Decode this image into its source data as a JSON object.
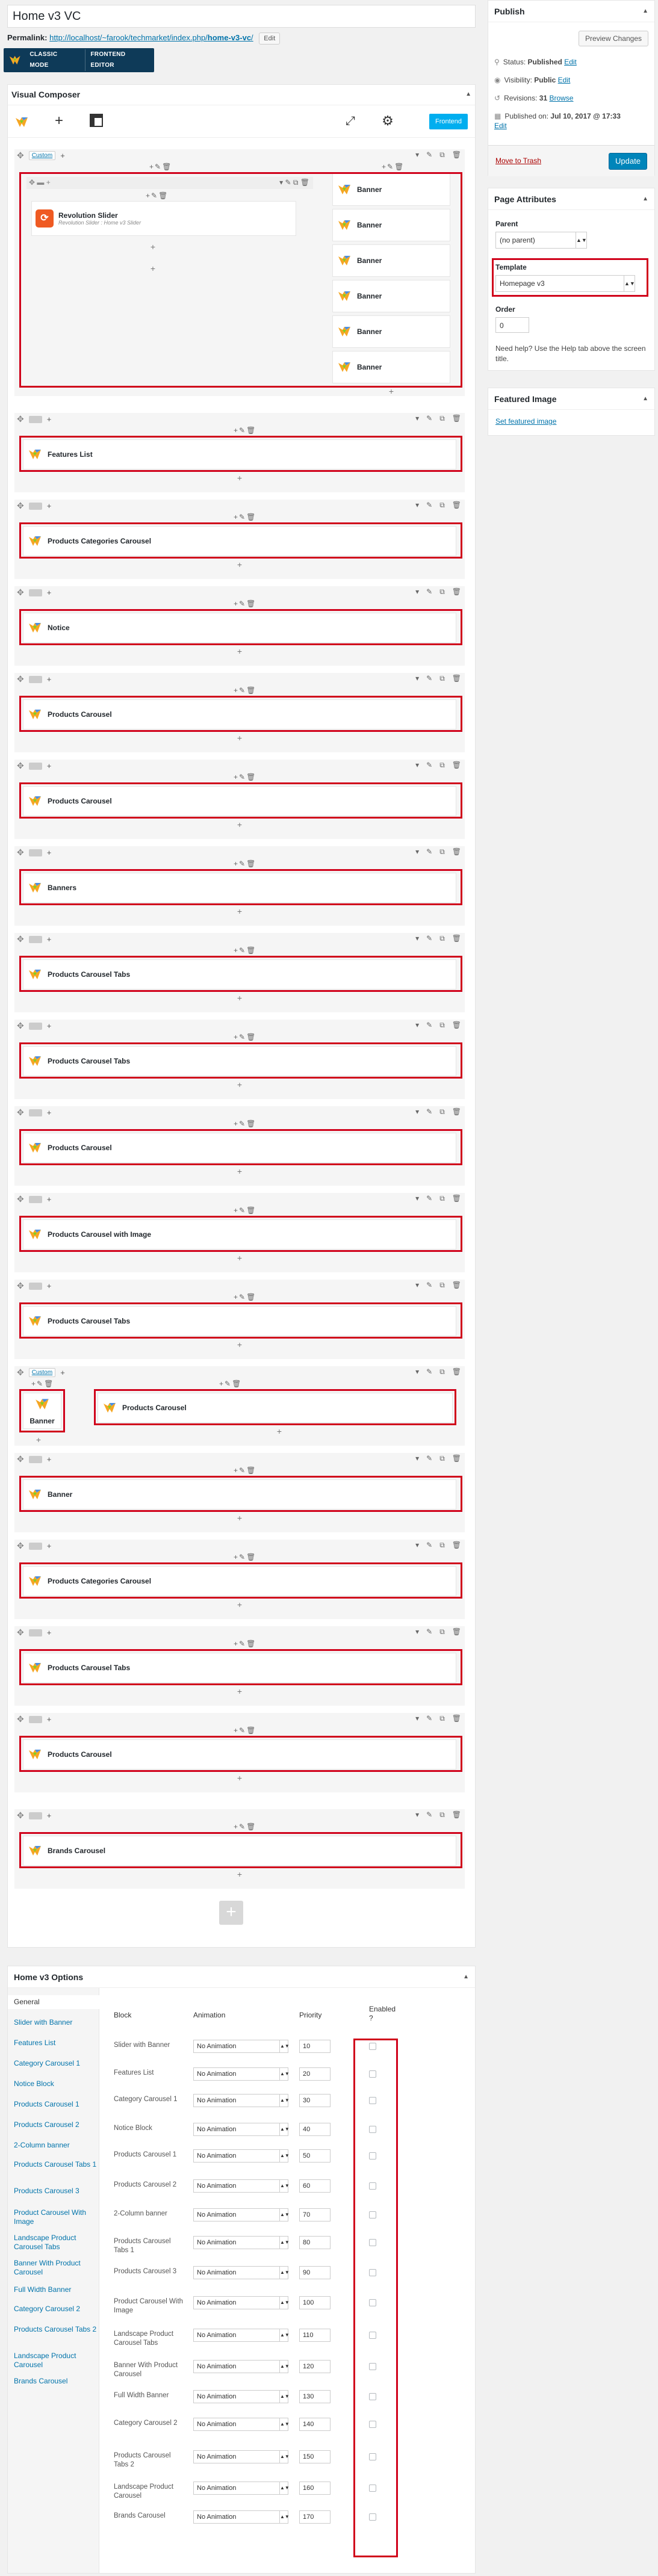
{
  "page_title": "Home v3 VC",
  "permalink": {
    "label": "Permalink:",
    "url_prefix": "http://localhost/~farook/techmarket/index.php/",
    "url_slug": "home-v3-vc",
    "url_suffix": "/",
    "edit": "Edit"
  },
  "mode": {
    "classic": "CLASSIC MODE",
    "frontend": "FRONTEND EDITOR"
  },
  "vc": {
    "title": "Visual Composer",
    "frontend": "Frontend",
    "custom": "Custom"
  },
  "rev_slider": {
    "name": "Revolution Slider",
    "sub": "Revolution Slider : Home v3 Slider"
  },
  "banner_label": "Banner",
  "rows": [
    "Features List",
    "Products Categories Carousel",
    "Notice",
    "Products Carousel",
    "Products Carousel",
    "Banners",
    "Products Carousel Tabs",
    "Products Carousel Tabs",
    "Products Carousel",
    "Products Carousel with Image",
    "Products Carousel Tabs"
  ],
  "split_row": {
    "left": "Banner",
    "right": "Products Carousel"
  },
  "rows2": [
    "Banner",
    "Products Categories Carousel",
    "Products Carousel Tabs",
    "Products Carousel",
    "Brands Carousel"
  ],
  "publish": {
    "title": "Publish",
    "preview": "Preview Changes",
    "status_l": "Status:",
    "status_v": "Published",
    "visibility_l": "Visibility:",
    "visibility_v": "Public",
    "revisions_l": "Revisions:",
    "revisions_v": "31",
    "browse": "Browse",
    "published_l": "Published on:",
    "published_v": "Jul 10, 2017 @ 17:33",
    "edit": "Edit",
    "trash": "Move to Trash",
    "update": "Update"
  },
  "attrs": {
    "title": "Page Attributes",
    "parent_l": "Parent",
    "parent_v": "(no parent)",
    "template_l": "Template",
    "template_v": "Homepage v3",
    "order_l": "Order",
    "order_v": "0",
    "help": "Need help? Use the Help tab above the screen title."
  },
  "featured": {
    "title": "Featured Image",
    "link": "Set featured image"
  },
  "options": {
    "title": "Home v3 Options",
    "tabs": [
      "General",
      "Slider with Banner",
      "Features List",
      "Category Carousel 1",
      "Notice Block",
      "Products Carousel 1",
      "Products Carousel 2",
      "2-Column banner",
      "Products Carousel Tabs 1",
      "Products Carousel 3",
      "Product Carousel With Image",
      "Landscape Product Carousel Tabs",
      "Banner With Product Carousel",
      "Full Width Banner",
      "Category Carousel 2",
      "Products Carousel Tabs 2",
      "Landscape Product Carousel",
      "Brands Carousel"
    ],
    "headers": {
      "block": "Block",
      "animation": "Animation",
      "priority": "Priority",
      "enabled": "Enabled ?"
    },
    "rows": [
      {
        "block": "Slider with Banner",
        "anim": "No Animation",
        "pri": "10"
      },
      {
        "block": "Features List",
        "anim": "No Animation",
        "pri": "20"
      },
      {
        "block": "Category Carousel 1",
        "anim": "No Animation",
        "pri": "30"
      },
      {
        "block": "Notice Block",
        "anim": "No Animation",
        "pri": "40"
      },
      {
        "block": "Products Carousel 1",
        "anim": "No Animation",
        "pri": "50"
      },
      {
        "block": "Products Carousel 2",
        "anim": "No Animation",
        "pri": "60"
      },
      {
        "block": "2-Column banner",
        "anim": "No Animation",
        "pri": "70"
      },
      {
        "block": "Products Carousel Tabs 1",
        "anim": "No Animation",
        "pri": "80"
      },
      {
        "block": "Products Carousel 3",
        "anim": "No Animation",
        "pri": "90"
      },
      {
        "block": "Product Carousel With Image",
        "anim": "No Animation",
        "pri": "100"
      },
      {
        "block": "Landscape Product Carousel Tabs",
        "anim": "No Animation",
        "pri": "110"
      },
      {
        "block": "Banner With Product Carousel",
        "anim": "No Animation",
        "pri": "120"
      },
      {
        "block": "Full Width Banner",
        "anim": "No Animation",
        "pri": "130"
      },
      {
        "block": "Category Carousel 2",
        "anim": "No Animation",
        "pri": "140"
      },
      {
        "block": "Products Carousel Tabs 2",
        "anim": "No Animation",
        "pri": "150"
      },
      {
        "block": "Landscape Product Carousel",
        "anim": "No Animation",
        "pri": "160"
      },
      {
        "block": "Brands Carousel",
        "anim": "No Animation",
        "pri": "170"
      }
    ]
  },
  "colors": {
    "highlight": "#d0021b",
    "accent": "#0073aa",
    "frontend": "#00aeef",
    "update": "#0085ba"
  }
}
